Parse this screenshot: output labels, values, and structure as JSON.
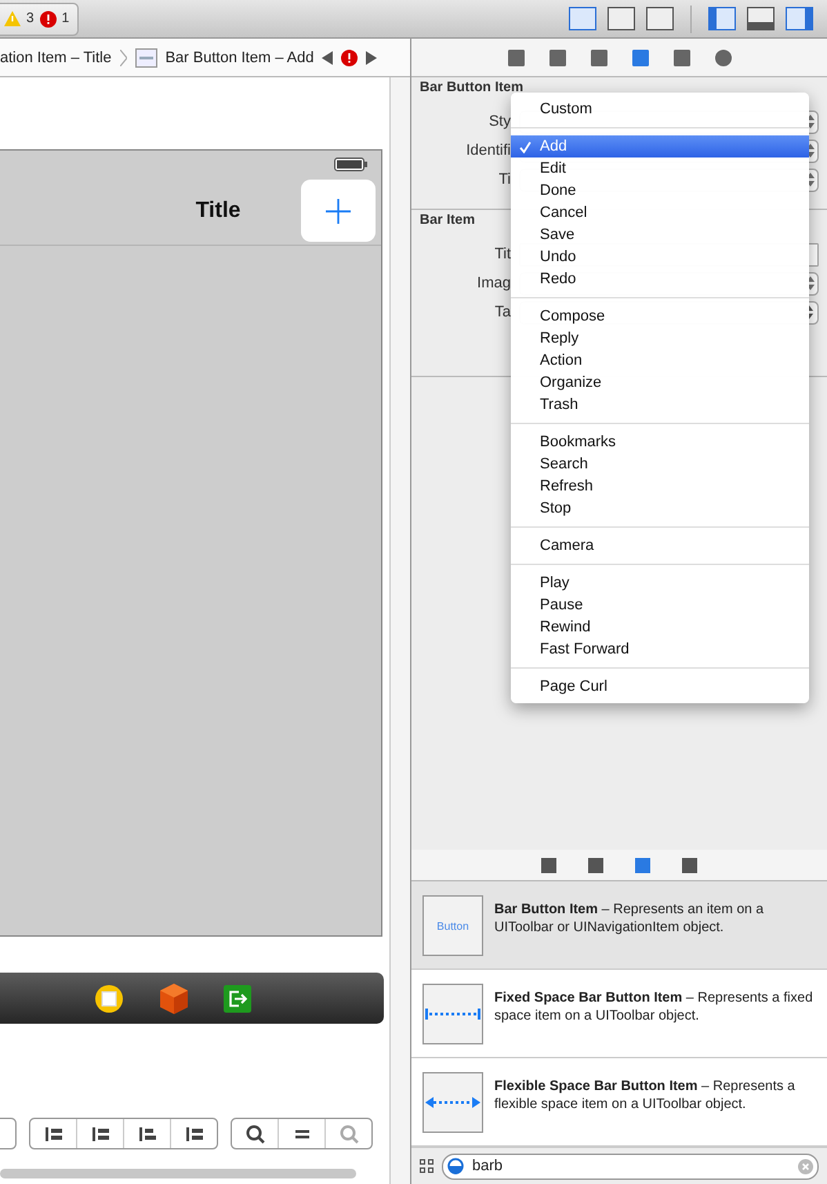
{
  "toolbar": {
    "warning_count": "3",
    "error_count": "1",
    "editor_buttons": [
      {
        "selected": true
      },
      {
        "selected": false
      },
      {
        "selected": false
      }
    ],
    "view_buttons": [
      {
        "selected": true
      },
      {
        "selected": false
      },
      {
        "selected": true
      }
    ]
  },
  "breadcrumb": {
    "items": [
      "ation Item – Title",
      "Bar Button Item – Add"
    ]
  },
  "canvas": {
    "nav_title": "Title"
  },
  "inspector": {
    "tabs": [
      {
        "selected": false
      },
      {
        "selected": false
      },
      {
        "selected": false
      },
      {
        "selected": true
      },
      {
        "selected": false
      },
      {
        "selected": false
      }
    ],
    "sections": [
      {
        "title": "Bar Button Item",
        "fields": [
          {
            "label": "Sty",
            "kind": "popup"
          },
          {
            "label": "Identifi",
            "kind": "popup"
          },
          {
            "label": "Ti",
            "kind": "popup"
          }
        ]
      },
      {
        "title": "Bar Item",
        "fields": [
          {
            "label": "Tit",
            "kind": "text"
          },
          {
            "label": "Imag",
            "kind": "popup"
          },
          {
            "label": "Ta",
            "kind": "stepper"
          }
        ]
      }
    ]
  },
  "menu": {
    "groups": [
      [
        {
          "label": "Custom",
          "selected": false
        }
      ],
      [
        {
          "label": "Add",
          "selected": true
        },
        {
          "label": "Edit",
          "selected": false
        },
        {
          "label": "Done",
          "selected": false
        },
        {
          "label": "Cancel",
          "selected": false
        },
        {
          "label": "Save",
          "selected": false
        },
        {
          "label": "Undo",
          "selected": false
        },
        {
          "label": "Redo",
          "selected": false
        }
      ],
      [
        {
          "label": "Compose",
          "selected": false
        },
        {
          "label": "Reply",
          "selected": false
        },
        {
          "label": "Action",
          "selected": false
        },
        {
          "label": "Organize",
          "selected": false
        },
        {
          "label": "Trash",
          "selected": false
        }
      ],
      [
        {
          "label": "Bookmarks",
          "selected": false
        },
        {
          "label": "Search",
          "selected": false
        },
        {
          "label": "Refresh",
          "selected": false
        },
        {
          "label": "Stop",
          "selected": false
        }
      ],
      [
        {
          "label": "Camera",
          "selected": false
        }
      ],
      [
        {
          "label": "Play",
          "selected": false
        },
        {
          "label": "Pause",
          "selected": false
        },
        {
          "label": "Rewind",
          "selected": false
        },
        {
          "label": "Fast Forward",
          "selected": false
        }
      ],
      [
        {
          "label": "Page Curl",
          "selected": false
        }
      ]
    ]
  },
  "library": {
    "tabs": [
      {
        "selected": false
      },
      {
        "selected": false
      },
      {
        "selected": true
      },
      {
        "selected": false
      }
    ],
    "items": [
      {
        "kind": "button",
        "preview_text": "Button",
        "description": "**Bar Button Item** – Represents an item on a UIToolbar or UINavigationItem object.",
        "selected": true
      },
      {
        "kind": "fixed",
        "description": "**Fixed Space Bar Button Item** – Represents a fixed space item on a UIToolbar object.",
        "selected": false
      },
      {
        "kind": "flexible",
        "description": "**Flexible Space Bar Button Item** – Represents a flexible space item on a UIToolbar object.",
        "selected": false
      }
    ],
    "search": {
      "value": "barb"
    }
  }
}
